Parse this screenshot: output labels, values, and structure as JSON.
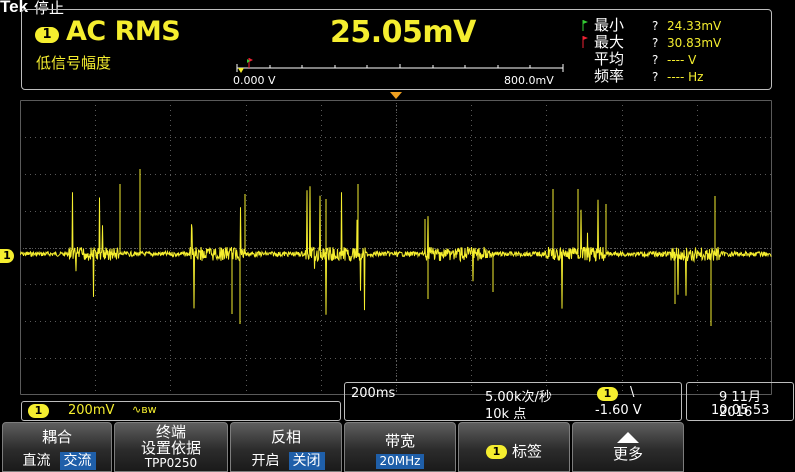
{
  "header": {
    "brand": "Tek",
    "state": "停止"
  },
  "measurement": {
    "channel": "1",
    "name": "AC RMS",
    "subtitle": "低信号幅度",
    "value": "25.05mV",
    "slider_min": "0.000 V",
    "slider_max": "800.0mV",
    "stats": [
      {
        "label": "最小",
        "q": "?",
        "value": "24.33mV"
      },
      {
        "label": "最大",
        "q": "?",
        "value": "30.83mV"
      },
      {
        "label": "平均",
        "q": "?",
        "value": "---- V"
      },
      {
        "label": "频率",
        "q": "?",
        "value": "---- Hz"
      }
    ]
  },
  "waveform": {
    "channel_marker": "1",
    "color": "#f5ee2f"
  },
  "channel_info": {
    "channel": "1",
    "scale": "200mV",
    "coupling_symbol": "∿ʙᴡ"
  },
  "timebase": {
    "time_per_div": "200ms",
    "sample_rate": "5.00k次/秒",
    "record_length": "10k 点",
    "trigger_channel": "1",
    "trigger_slope": "\\",
    "trigger_level": "-1.60 V"
  },
  "datetime": {
    "date": "9 11月2016",
    "time": "10:05:53"
  },
  "softkeys": {
    "coupling": {
      "title": "耦合",
      "opt1": "直流",
      "opt2": "交流"
    },
    "termination": {
      "title1": "终端",
      "title2": "设置依据",
      "value": "TPP0250"
    },
    "invert": {
      "title": "反相",
      "opt1": "开启",
      "opt2": "关闭"
    },
    "bandwidth": {
      "title": "带宽",
      "value": "20MHz"
    },
    "label": {
      "chip": "1",
      "title": "标签"
    },
    "more": {
      "title": "更多"
    }
  },
  "colors": {
    "trace": "#f5ee2f",
    "selected": "#1f5fa9",
    "trigger_marker": "#f0a020",
    "grid": "#5a5a5a"
  }
}
